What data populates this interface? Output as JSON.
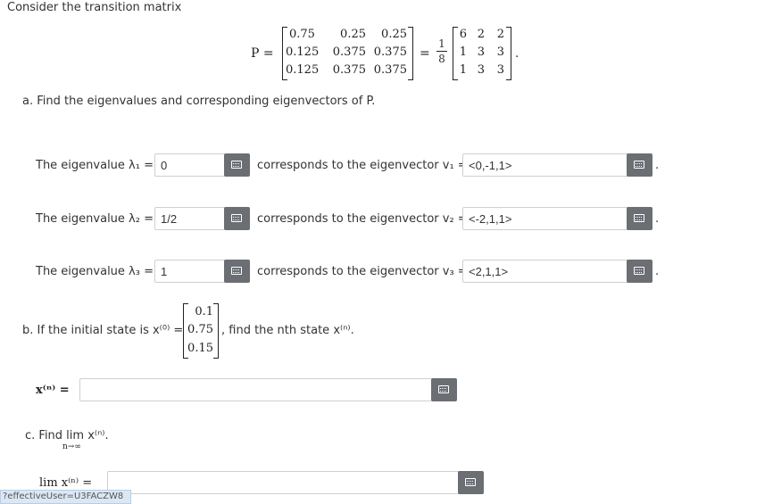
{
  "intro": "Consider the transition matrix",
  "matrix": {
    "lhs": "P =",
    "rows": [
      [
        "0.75",
        "0.25",
        "0.25"
      ],
      [
        "0.125",
        "0.375",
        "0.375"
      ],
      [
        "0.125",
        "0.375",
        "0.375"
      ]
    ],
    "eq": "=",
    "frac_num": "1",
    "frac_den": "8",
    "int_rows": [
      [
        "6",
        "2",
        "2"
      ],
      [
        "1",
        "3",
        "3"
      ],
      [
        "1",
        "3",
        "3"
      ]
    ],
    "end": "."
  },
  "part_a": {
    "prompt": "a. Find the eigenvalues and corresponding eigenvectors of P.",
    "rows": [
      {
        "label": "The eigenvalue λ₁ =",
        "value": "0",
        "mid": "corresponds to the eigenvector v₁ =",
        "vector": "<0,-1,1>",
        "end": "."
      },
      {
        "label": "The eigenvalue λ₂ =",
        "value": "1/2",
        "mid": "corresponds to the eigenvector v₂ =",
        "vector": "<-2,1,1>",
        "end": "."
      },
      {
        "label": "The eigenvalue λ₃ =",
        "value": "1",
        "mid": "corresponds to the eigenvector v₃ =",
        "vector": "<2,1,1>",
        "end": "."
      }
    ]
  },
  "part_b": {
    "prompt_pre": "b. If the initial state is x⁽⁰⁾ =",
    "vector": [
      "0.1",
      "0.75",
      "0.15"
    ],
    "prompt_post": ", find the nth state x⁽ⁿ⁾.",
    "answer_label": "x⁽ⁿ⁾ =",
    "answer_value": ""
  },
  "part_c": {
    "prompt": "c. Find  lim  x⁽ⁿ⁾.",
    "limit_sub": "n→∞",
    "answer_label": "lim x⁽ⁿ⁾ =",
    "answer_value": ""
  },
  "url_fragment": "?effectiveUser=U3FACZW8"
}
